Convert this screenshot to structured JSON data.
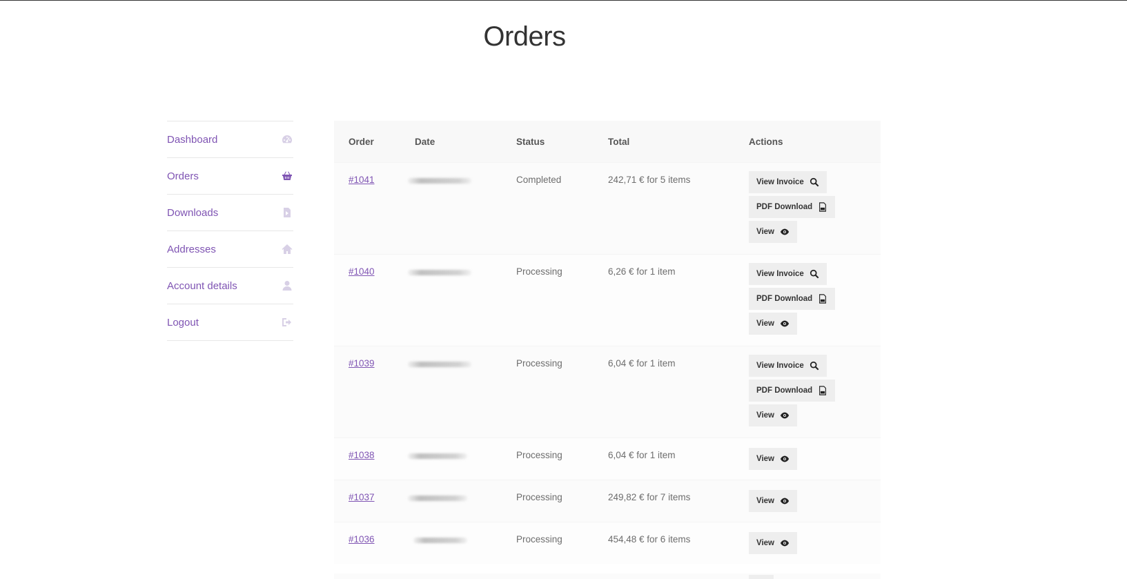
{
  "page": {
    "title": "Orders"
  },
  "sidebar": {
    "items": [
      {
        "label": "Dashboard",
        "icon": "dashboard-icon",
        "active": false
      },
      {
        "label": "Orders",
        "icon": "basket-icon",
        "active": true
      },
      {
        "label": "Downloads",
        "icon": "file-icon",
        "active": false
      },
      {
        "label": "Addresses",
        "icon": "home-icon",
        "active": false
      },
      {
        "label": "Account details",
        "icon": "user-icon",
        "active": false
      },
      {
        "label": "Logout",
        "icon": "sign-out-icon",
        "active": false
      }
    ]
  },
  "table": {
    "headers": {
      "order": "Order",
      "date": "Date",
      "status": "Status",
      "total": "Total",
      "actions": "Actions"
    },
    "buttons": {
      "view_invoice": "View Invoice",
      "pdf_download": "PDF Download",
      "view": "View"
    },
    "rows": [
      {
        "order": "#1041",
        "status": "Completed",
        "total": "242,71 € for 5 items"
      },
      {
        "order": "#1040",
        "status": "Processing",
        "total": "6,26 € for 1 item"
      },
      {
        "order": "#1039",
        "status": "Processing",
        "total": "6,04 € for 1 item"
      },
      {
        "order": "#1038",
        "status": "Processing",
        "total": "6,04 € for 1 item"
      },
      {
        "order": "#1037",
        "status": "Processing",
        "total": "249,82 € for 7 items"
      },
      {
        "order": "#1036",
        "status": "Processing",
        "total": "454,48 € for 6 items"
      }
    ]
  },
  "colors": {
    "accent": "#7f54b3",
    "button_bg": "#eeeeee",
    "header_bg": "#f8f8f8"
  }
}
